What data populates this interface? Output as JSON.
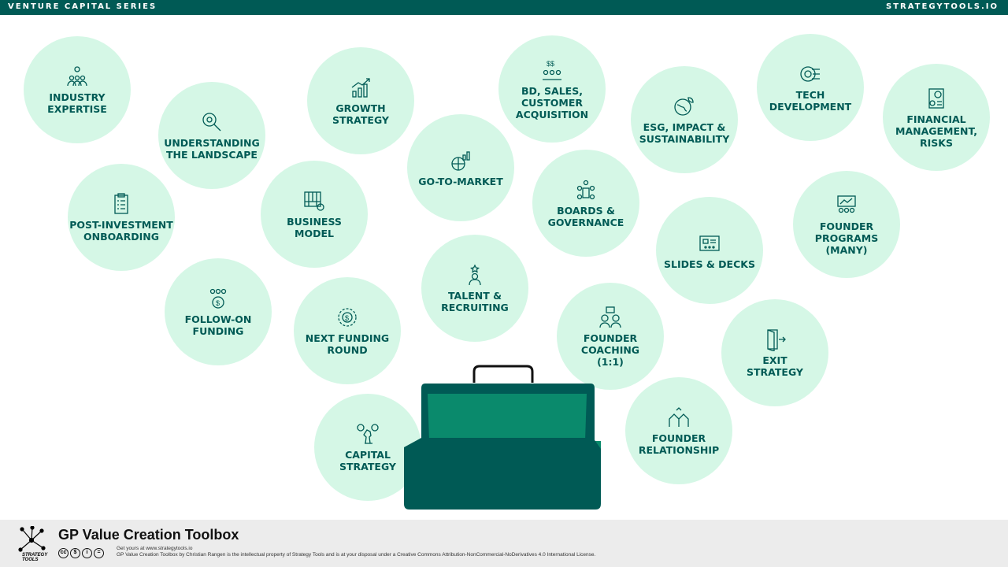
{
  "header": {
    "series": "VENTURE CAPITAL SERIES",
    "site": "STRATEGYTOOLS.IO"
  },
  "bubbles": [
    {
      "label": "INDUSTRY\nEXPERTISE",
      "icon": "team-gear-icon"
    },
    {
      "label": "UNDERSTANDING\nTHE LANDSCAPE",
      "icon": "magnifier-gear-icon"
    },
    {
      "label": "GROWTH\nSTRATEGY",
      "icon": "growth-chart-icon"
    },
    {
      "label": "BD, SALES,\nCUSTOMER\nACQUISITION",
      "icon": "dollar-people-icon"
    },
    {
      "label": "ESG, IMPACT &\nSUSTAINABILITY",
      "icon": "globe-leaf-icon"
    },
    {
      "label": "TECH\nDEVELOPMENT",
      "icon": "gear-circuit-icon"
    },
    {
      "label": "FINANCIAL\nMANAGEMENT,\nRISKS",
      "icon": "financial-report-icon"
    },
    {
      "label": "POST-INVESTMENT\nONBOARDING",
      "icon": "clipboard-icon"
    },
    {
      "label": "BUSINESS\nMODEL",
      "icon": "canvas-gear-icon"
    },
    {
      "label": "GO-TO-MARKET",
      "icon": "globe-chart-icon"
    },
    {
      "label": "BOARDS &\nGOVERNANCE",
      "icon": "boardroom-icon"
    },
    {
      "label": "SLIDES & DECKS",
      "icon": "presentation-icon"
    },
    {
      "label": "FOUNDER\nPROGRAMS\n(MANY)",
      "icon": "group-board-icon"
    },
    {
      "label": "FOLLOW-ON\nFUNDING",
      "icon": "people-coin-icon"
    },
    {
      "label": "NEXT FUNDING\nROUND",
      "icon": "coin-gear-icon"
    },
    {
      "label": "TALENT &\nRECRUITING",
      "icon": "person-star-icon"
    },
    {
      "label": "FOUNDER\nCOACHING\n(1:1)",
      "icon": "coaching-chat-icon"
    },
    {
      "label": "EXIT\nSTRATEGY",
      "icon": "exit-door-icon"
    },
    {
      "label": "CAPITAL\nSTRATEGY",
      "icon": "chess-coin-icon"
    },
    {
      "label": "FOUNDER\nRELATIONSHIP",
      "icon": "handshake-people-icon"
    }
  ],
  "footer": {
    "title": "GP Value Creation Toolbox",
    "logo_text": "STRATEGY\nTOOLS",
    "line1": "Get yours at www.strategytools.io",
    "line2": "GP Value Creation Toolbox by Christian Rangen is the intellectual property of Strategy Tools and is at your disposal under a Creative Commons Attribution-NonCommercial-NoDerivatives 4.0 International License.",
    "cc_badges": [
      "cc",
      "$",
      "i",
      "="
    ]
  },
  "colors": {
    "dark": "#005a55",
    "bubble": "#d5f7e6",
    "toolbox_lid": "#0a8a6c",
    "toolbox_body": "#005a55"
  }
}
